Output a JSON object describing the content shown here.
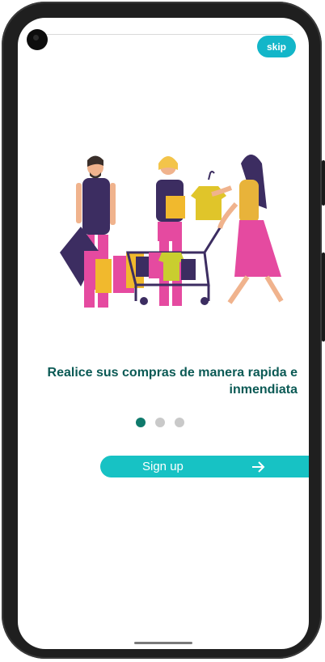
{
  "header": {
    "skip_label": "skip"
  },
  "onboarding": {
    "title": "Realice sus compras de manera rapida e inmendiata",
    "pagination": {
      "current": 1,
      "total": 3
    },
    "cta_label": "Sign up"
  },
  "colors": {
    "accent": "#13b6c9",
    "cta": "#17c2c4",
    "title": "#0b5a55",
    "dot_active": "#0f7a6c",
    "dot_inactive": "#c9c9c9"
  },
  "icons": {
    "cta_icon": "arrow-right-icon",
    "camera": "front-camera-icon"
  }
}
